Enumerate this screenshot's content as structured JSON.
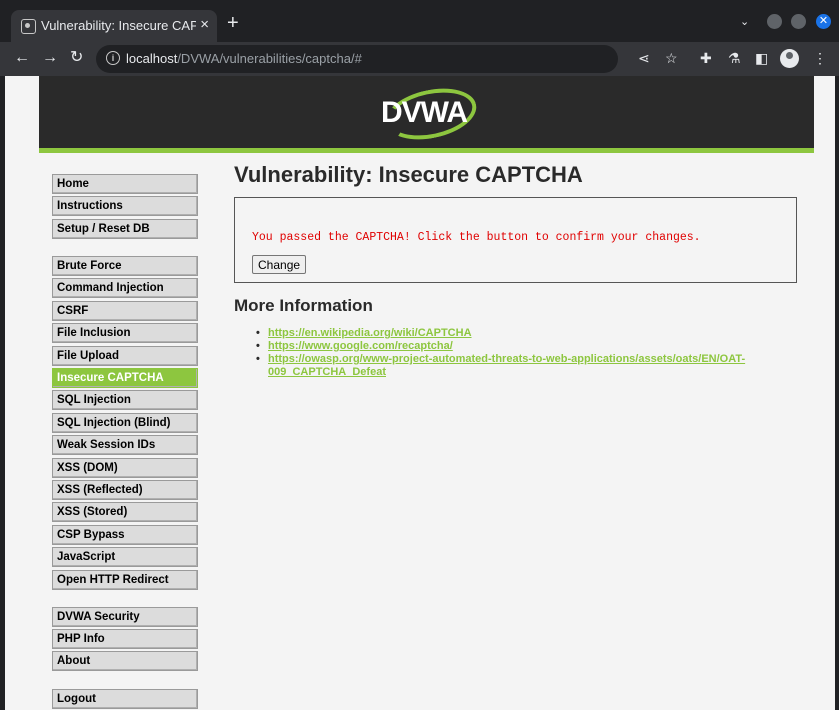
{
  "browser": {
    "tab_title": "Vulnerability: Insecure CAPTCHA",
    "tab_close": "×",
    "new_tab": "+",
    "tab_search": "⌄",
    "window_close": "✕",
    "url_host": "localhost",
    "url_path": "/DVWA/vulnerabilities/captcha/#"
  },
  "header": {
    "logo_text": "DVWA"
  },
  "menu": {
    "items": [
      "Home",
      "Instructions",
      "Setup / Reset DB",
      "Brute Force",
      "Command Injection",
      "CSRF",
      "File Inclusion",
      "File Upload",
      "Insecure CAPTCHA",
      "SQL Injection",
      "SQL Injection (Blind)",
      "Weak Session IDs",
      "XSS (DOM)",
      "XSS (Reflected)",
      "XSS (Stored)",
      "CSP Bypass",
      "JavaScript",
      "Open HTTP Redirect",
      "DVWA Security",
      "PHP Info",
      "About",
      "Logout"
    ],
    "selected": "Insecure CAPTCHA"
  },
  "main": {
    "title": "Vulnerability: Insecure CAPTCHA",
    "message": "You passed the CAPTCHA! Click the button to confirm your changes.",
    "change_button": "Change",
    "more_info_heading": "More Information",
    "links": [
      "https://en.wikipedia.org/wiki/CAPTCHA",
      "https://www.google.com/recaptcha/",
      "https://owasp.org/www-project-automated-threats-to-web-applications/assets/oats/EN/OAT-009_CAPTCHA_Defeat"
    ]
  },
  "colors": {
    "accent": "#8dc63f",
    "header_bg": "#2a2a2a",
    "error": "#e00000"
  }
}
